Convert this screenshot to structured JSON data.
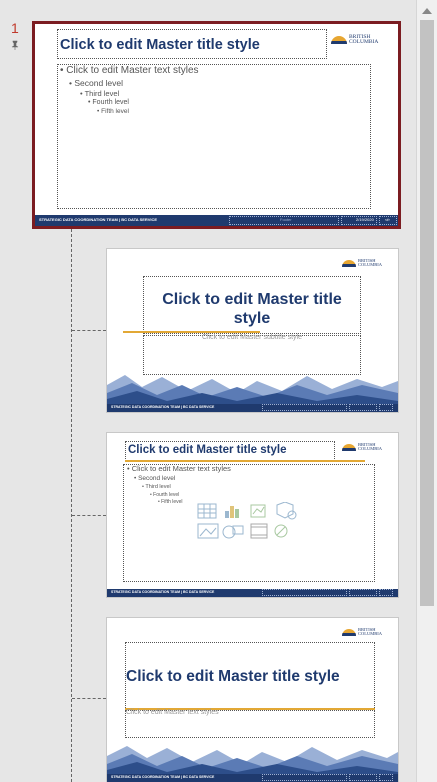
{
  "thumbnails": {
    "master": {
      "number": "1",
      "title": "Click to edit Master title style",
      "body_levels": [
        "Click to edit Master text styles",
        "Second level",
        "Third level",
        "Fourth level",
        "Fifth level"
      ],
      "footer_org": "STRATEGIC DATA COORDINATION TEAM | BC DATA SERVICE",
      "footer_center": "Footer",
      "footer_date": "2/19/2020",
      "footer_slide_num": "‹#›"
    },
    "logo_line1": "BRITISH",
    "logo_line2": "COLUMBIA",
    "layout_title": {
      "title": "Click to edit Master title style",
      "subtitle": "Click to edit Master subtitle style",
      "footer_org": "STRATEGIC DATA COORDINATION TEAM | BC DATA SERVICE"
    },
    "layout_content": {
      "title": "Click to edit Master title style",
      "body_levels": [
        "Click to edit Master text styles",
        "Second level",
        "Third level",
        "Fourth level",
        "Fifth level"
      ],
      "footer_org": "STRATEGIC DATA COORDINATION TEAM | BC DATA SERVICE"
    },
    "layout_section": {
      "title": "Click to edit Master title style",
      "body": "Click to edit Master text styles",
      "footer_org": "STRATEGIC DATA COORDINATION TEAM | BC DATA SERVICE"
    }
  },
  "colors": {
    "selected_border": "#7b1c21",
    "bc_blue": "#1f3a6e",
    "bc_gold": "#e2a835"
  }
}
